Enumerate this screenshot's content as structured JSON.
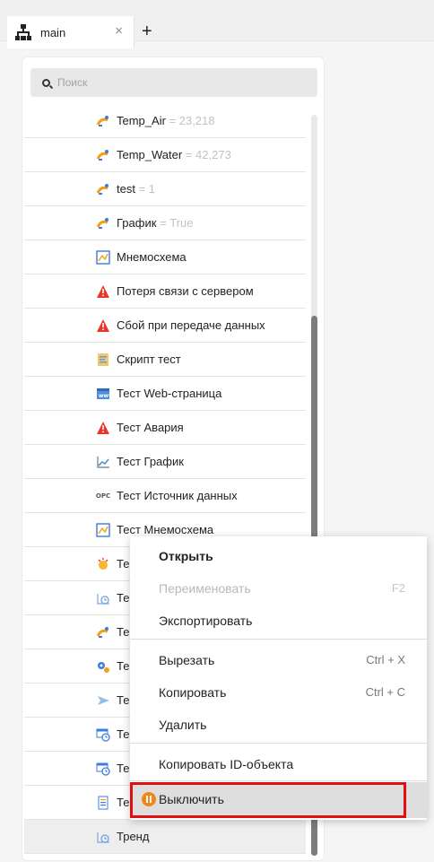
{
  "tab": {
    "label": "main",
    "close": "×",
    "add": "+"
  },
  "search": {
    "placeholder": "Поиск"
  },
  "items": [
    {
      "name": "Temp_Air",
      "value": " = 23,218",
      "icon": "variable-icon"
    },
    {
      "name": "Temp_Water",
      "value": " = 42,273",
      "icon": "variable-icon"
    },
    {
      "name": "test",
      "value": " = 1",
      "icon": "variable-icon"
    },
    {
      "name": "График",
      "value": " = True",
      "icon": "variable-icon"
    },
    {
      "name": "Мнемосхема",
      "value": "",
      "icon": "mnemoscheme-icon"
    },
    {
      "name": "Потеря связи с сервером",
      "value": "",
      "icon": "alarm-icon"
    },
    {
      "name": "Сбой при передаче данных",
      "value": "",
      "icon": "alarm-icon"
    },
    {
      "name": "Скрипт тест",
      "value": "",
      "icon": "script-icon"
    },
    {
      "name": "Тест Web-страница",
      "value": "",
      "icon": "web-page-icon"
    },
    {
      "name": "Тест Авария",
      "value": "",
      "icon": "alarm-icon"
    },
    {
      "name": "Тест График",
      "value": "",
      "icon": "chart-icon"
    },
    {
      "name": "Тест Источник данных",
      "value": "",
      "icon": "opc-icon"
    },
    {
      "name": "Тест Мнемосхема",
      "value": "",
      "icon": "mnemoscheme-icon"
    },
    {
      "name": "Те",
      "value": "",
      "icon": "alert-icon"
    },
    {
      "name": "Те",
      "value": "",
      "icon": "trend-icon"
    },
    {
      "name": "Те",
      "value": "",
      "icon": "variable-icon"
    },
    {
      "name": "Те",
      "value": "",
      "icon": "gear-icon"
    },
    {
      "name": "Те",
      "value": "",
      "icon": "send-icon"
    },
    {
      "name": "Те",
      "value": "",
      "icon": "schedule-icon"
    },
    {
      "name": "Те",
      "value": "",
      "icon": "schedule-icon"
    },
    {
      "name": "Те",
      "value": "",
      "icon": "report-icon"
    },
    {
      "name": "Тренд",
      "value": "",
      "icon": "trend-icon"
    }
  ],
  "context_menu": {
    "open": "Открыть",
    "rename": "Переименовать",
    "rename_shortcut": "F2",
    "export": "Экспортировать",
    "cut": "Вырезать",
    "cut_shortcut": "Ctrl + X",
    "copy": "Копировать",
    "copy_shortcut": "Ctrl + C",
    "delete": "Удалить",
    "copy_id": "Копировать ID-объекта",
    "disable": "Выключить"
  },
  "colors": {
    "alarm": "#e8362a",
    "variable": "#f2a019",
    "variable_accent": "#3c7be0",
    "highlight_border": "#e01010",
    "disable_icon": "#f0861a"
  }
}
